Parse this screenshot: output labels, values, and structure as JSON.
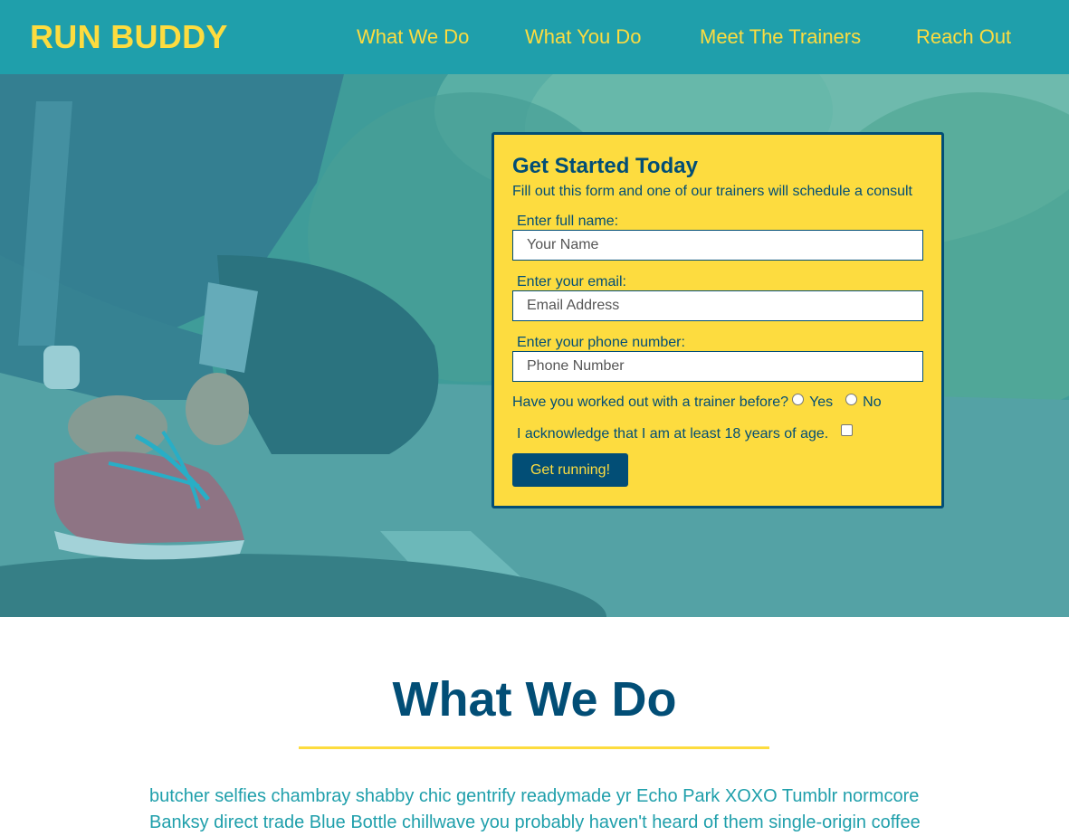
{
  "brand": {
    "logo": "RUN BUDDY",
    "colors": {
      "teal": "#1f9fab",
      "yellow": "#fddc3f",
      "navy": "#024e76"
    }
  },
  "nav": {
    "items": [
      "What We Do",
      "What You Do",
      "Meet The Trainers",
      "Reach Out"
    ]
  },
  "form": {
    "title": "Get Started Today",
    "subtitle": "Fill out this form and one of our trainers will schedule a consult",
    "name_label": "Enter full name:",
    "name_placeholder": "Your Name",
    "email_label": "Enter your email:",
    "email_placeholder": "Email Address",
    "phone_label": "Enter your phone number:",
    "phone_placeholder": "Phone Number",
    "trainer_question": "Have you worked out with a trainer before?",
    "option_yes": "Yes",
    "option_no": "No",
    "age_ack": "I acknowledge that I am at least 18 years of age.",
    "submit": "Get running!"
  },
  "what_we_do": {
    "title": "What We Do",
    "body": "butcher selfies chambray shabby chic gentrify readymade yr Echo Park XOXO Tumblr normcore Banksy direct trade Blue Bottle chillwave you probably haven't heard of them single-origin coffee"
  }
}
